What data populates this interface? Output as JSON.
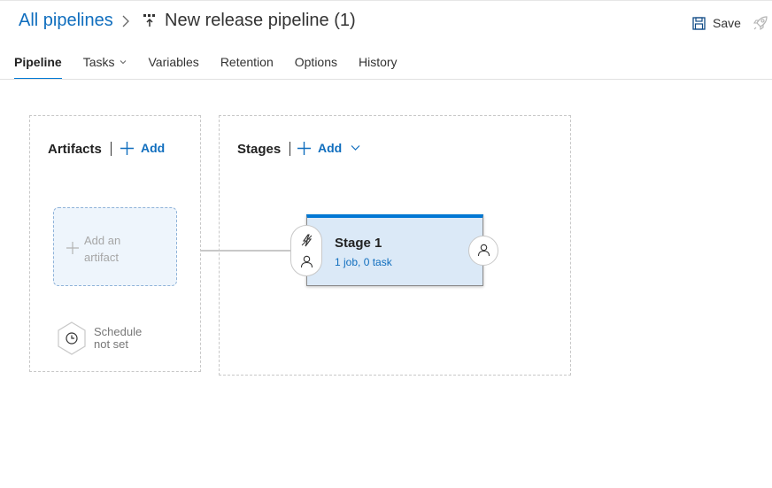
{
  "header": {
    "breadcrumb_root": "All pipelines",
    "pipeline_title": "New release pipeline (1)",
    "save_label": "Save"
  },
  "tabs": [
    {
      "label": "Pipeline",
      "active": true
    },
    {
      "label": "Tasks",
      "has_dropdown": true
    },
    {
      "label": "Variables"
    },
    {
      "label": "Retention"
    },
    {
      "label": "Options"
    },
    {
      "label": "History"
    }
  ],
  "artifacts": {
    "title": "Artifacts",
    "add_label": "Add",
    "add_artifact_text": "Add an artifact",
    "schedule_text": "Schedule not set"
  },
  "stages": {
    "title": "Stages",
    "add_label": "Add",
    "items": [
      {
        "name": "Stage 1",
        "summary": "1 job, 0 task"
      }
    ]
  },
  "colors": {
    "accent": "#0078d4",
    "link": "#106ebe",
    "stage_fill": "#dbe9f7",
    "artifact_fill": "#eef5fc"
  },
  "icons": {
    "save": "save-icon",
    "release": "rocket-icon",
    "pipeline": "pipeline-icon",
    "schedule": "clock-icon",
    "trigger": "lightning-icon",
    "approver": "person-icon"
  }
}
